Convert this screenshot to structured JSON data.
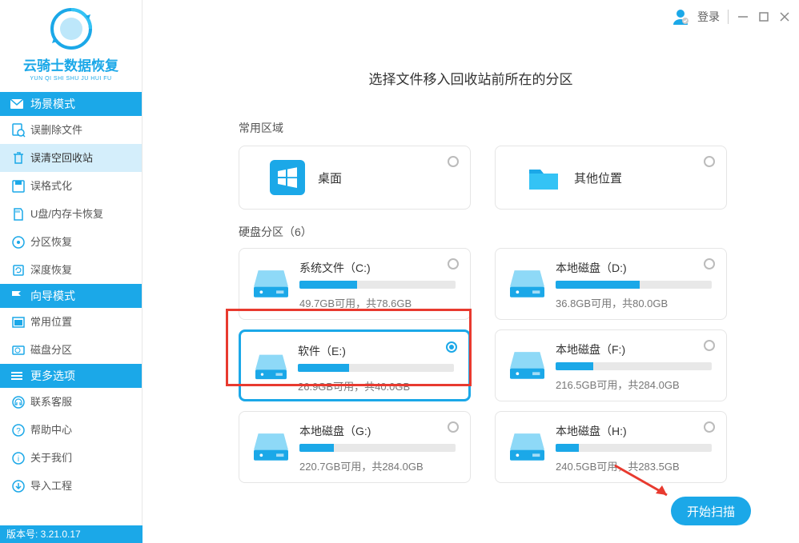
{
  "app": {
    "title": "云骑士数据恢复",
    "subtitle": "YUN QI SHI SHU JU HUI FU",
    "version_label": "版本号:  3.21.0.17"
  },
  "topbar": {
    "login": "登录"
  },
  "sidebar": {
    "sections": [
      {
        "header": "场景模式",
        "items": [
          {
            "label": "误删除文件"
          },
          {
            "label": "误清空回收站",
            "active": true
          },
          {
            "label": "误格式化"
          },
          {
            "label": "U盘/内存卡恢复"
          },
          {
            "label": "分区恢复"
          },
          {
            "label": "深度恢复"
          }
        ]
      },
      {
        "header": "向导模式",
        "items": [
          {
            "label": "常用位置"
          },
          {
            "label": "磁盘分区"
          }
        ]
      },
      {
        "header": "更多选项",
        "items": [
          {
            "label": "联系客服"
          },
          {
            "label": "帮助中心"
          },
          {
            "label": "关于我们"
          },
          {
            "label": "导入工程"
          }
        ]
      }
    ]
  },
  "main": {
    "title": "选择文件移入回收站前所在的分区",
    "common_area_label": "常用区域",
    "disk_section_label": "硬盘分区（6）",
    "common_cards": [
      {
        "title": "桌面"
      },
      {
        "title": "其他位置"
      }
    ],
    "disks": [
      {
        "name": "系统文件（C:)",
        "detail": "49.7GB可用，共78.6GB",
        "used_pct": 37
      },
      {
        "name": "本地磁盘（D:)",
        "detail": "36.8GB可用，共80.0GB",
        "used_pct": 54
      },
      {
        "name": "软件（E:)",
        "detail": "26.9GB可用，共40.0GB",
        "used_pct": 33,
        "selected": true
      },
      {
        "name": "本地磁盘（F:)",
        "detail": "216.5GB可用，共284.0GB",
        "used_pct": 24
      },
      {
        "name": "本地磁盘（G:)",
        "detail": "220.7GB可用，共284.0GB",
        "used_pct": 22
      },
      {
        "name": "本地磁盘（H:)",
        "detail": "240.5GB可用，共283.5GB",
        "used_pct": 15
      }
    ],
    "scan_button": "开始扫描"
  }
}
